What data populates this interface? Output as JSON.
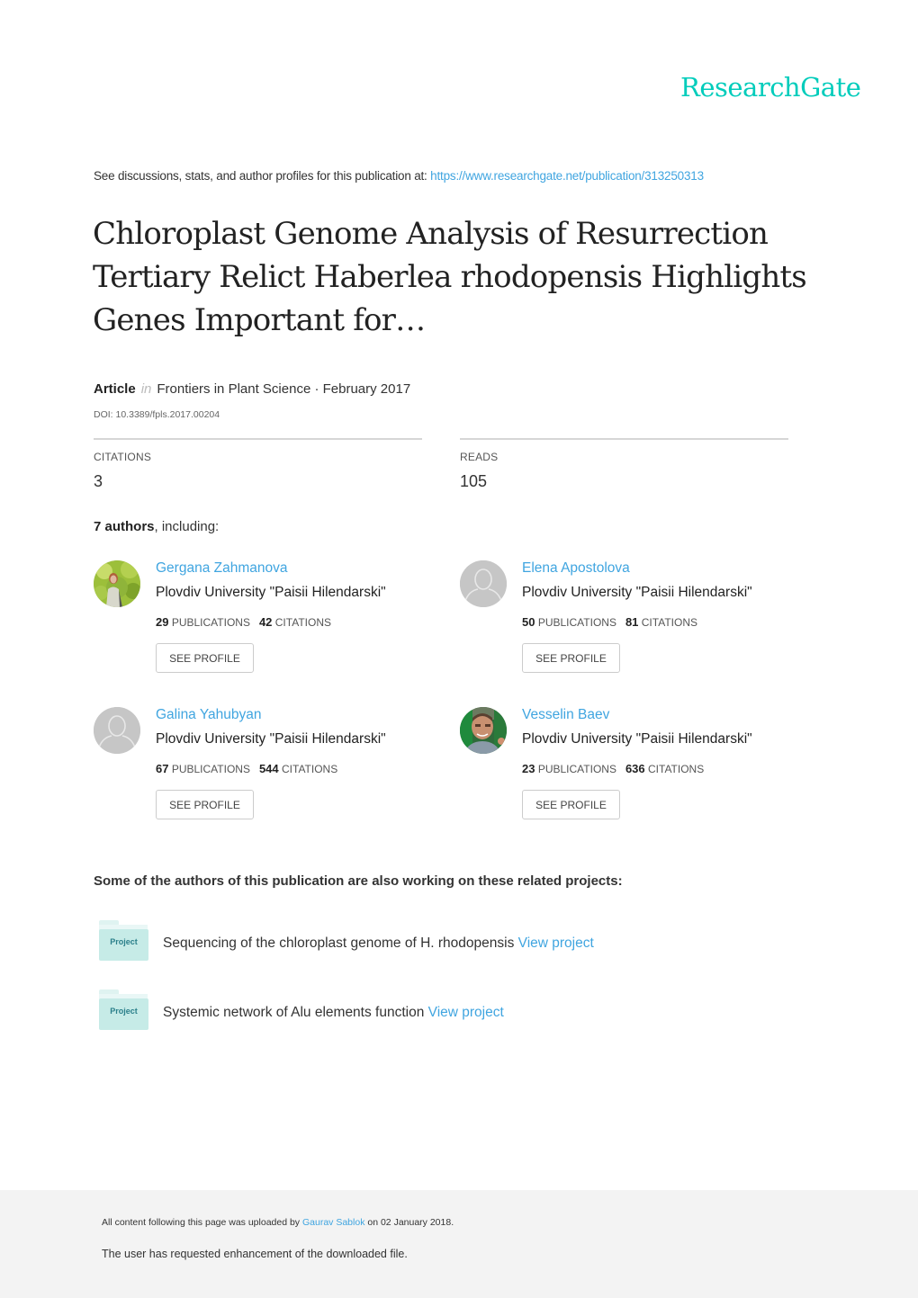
{
  "brand": {
    "logo_text": "ResearchGate",
    "accent_color": "#00ccbb",
    "link_color": "#40a5e0"
  },
  "discussions": {
    "prefix": "See discussions, stats, and author profiles for this publication at: ",
    "url": "https://www.researchgate.net/publication/313250313"
  },
  "publication": {
    "title": "Chloroplast Genome Analysis of Resurrection Tertiary Relict Haberlea rhodopensis Highlights Genes Important for…",
    "type": "Article",
    "in_label": "in",
    "journal_date": "Frontiers in Plant Science · February 2017",
    "doi": "DOI: 10.3389/fpls.2017.00204"
  },
  "stats": {
    "citations_label": "CITATIONS",
    "citations_value": "3",
    "reads_label": "READS",
    "reads_value": "105"
  },
  "authors_section": {
    "count_text": "7 authors",
    "suffix": ", including:"
  },
  "authors": [
    {
      "name": "Gergana Zahmanova",
      "institution": "Plovdiv University \"Paisii Hilendarski\"",
      "publications": "29",
      "publications_label": "PUBLICATIONS",
      "citations": "42",
      "citations_label": "CITATIONS",
      "button": "SEE PROFILE",
      "avatar": "photo-avatar"
    },
    {
      "name": "Elena Apostolova",
      "institution": "Plovdiv University \"Paisii Hilendarski\"",
      "publications": "50",
      "publications_label": "PUBLICATIONS",
      "citations": "81",
      "citations_label": "CITATIONS",
      "button": "SEE PROFILE",
      "avatar": "default-avatar"
    },
    {
      "name": "Galina Yahubyan",
      "institution": "Plovdiv University \"Paisii Hilendarski\"",
      "publications": "67",
      "publications_label": "PUBLICATIONS",
      "citations": "544",
      "citations_label": "CITATIONS",
      "button": "SEE PROFILE",
      "avatar": "default-avatar"
    },
    {
      "name": "Vesselin Baev",
      "institution": "Plovdiv University \"Paisii Hilendarski\"",
      "publications": "23",
      "publications_label": "PUBLICATIONS",
      "citations": "636",
      "citations_label": "CITATIONS",
      "button": "SEE PROFILE",
      "avatar": "photo-avatar"
    }
  ],
  "related": {
    "heading": "Some of the authors of this publication are also working on these related projects:",
    "projects": [
      {
        "icon_label": "Project",
        "title": "Sequencing of the chloroplast genome of H. rhodopensis",
        "link": "View project"
      },
      {
        "icon_label": "Project",
        "title": "Systemic network of Alu elements function",
        "link": "View project"
      }
    ]
  },
  "footer": {
    "uploaded_prefix": "All content following this page was uploaded by ",
    "uploader": "Gaurav Sablok",
    "uploaded_suffix": " on 02 January 2018.",
    "enhancement": "The user has requested enhancement of the downloaded file."
  }
}
